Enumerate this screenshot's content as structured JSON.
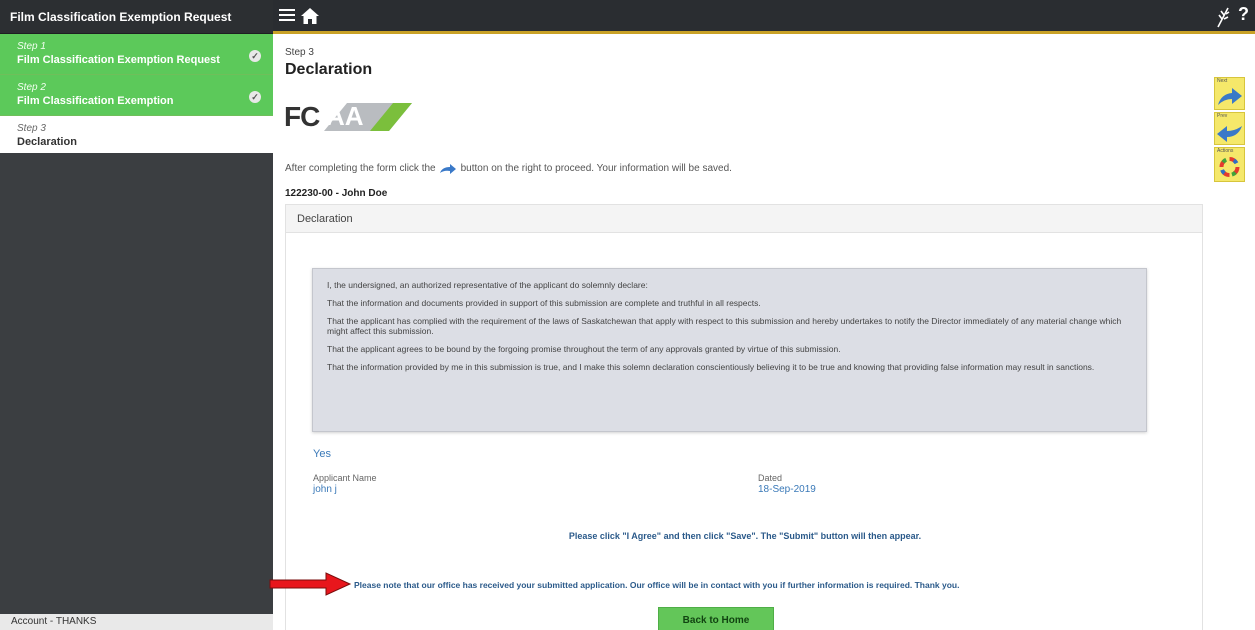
{
  "sidebar": {
    "title": "Film Classification Exemption Request",
    "steps": [
      {
        "num": "Step 1",
        "name": "Film Classification Exemption Request"
      },
      {
        "num": "Step 2",
        "name": "Film Classification Exemption"
      },
      {
        "num": "Step 3",
        "name": "Declaration"
      }
    ],
    "footer": "Account - THANKS"
  },
  "main": {
    "step_label": "Step 3",
    "title": "Declaration",
    "logo_text": "FC",
    "logo_text2": "AA",
    "instructions_before": "After completing the form click the",
    "instructions_after": "button on the right to proceed. Your information will be saved.",
    "applicant_id": "122230-00 - John Doe"
  },
  "panel": {
    "heading": "Declaration",
    "declaration_lines": [
      "I, the undersigned, an authorized representative of the applicant do solemnly declare:",
      "That the information and documents provided in support of this submission are complete and truthful in all respects.",
      "That the applicant has complied with the requirement of the laws of Saskatchewan that apply with respect to this submission and hereby undertakes to notify the Director immediately of any material change which might affect this submission.",
      "That the applicant agrees to be bound by the forgoing promise throughout the term of any approvals granted by virtue of this submission.",
      "That the information provided by me in this submission is true, and I make this solemn declaration conscientiously believing it to be true and knowing that providing false information may result in sanctions."
    ],
    "agreement": "Yes",
    "applicant_name_label": "Applicant Name",
    "applicant_name_value": "john j",
    "dated_label": "Dated",
    "dated_value": "18-Sep-2019",
    "note_agree": "Please click \"I Agree\" and then click \"Save\". The \"Submit\" button will then appear.",
    "note_received": "Please note that our office has received your submitted application. Our office will be in contact with you if further information is required. Thank you.",
    "back_button": "Back to Home"
  },
  "actions": {
    "next": "Next",
    "prev": "Prev",
    "actions": "Actions"
  },
  "topbar": {
    "help": "?"
  },
  "colors": {
    "accent_green": "#5cc95a",
    "topbar_accent": "#c9a227",
    "link_blue": "#3a79b8",
    "note_blue": "#2b5a8a",
    "action_yellow": "#f5e86a"
  },
  "icons": [
    "menu-icon",
    "home-icon",
    "wheat-icon",
    "help-icon",
    "check-icon",
    "next-arrow-icon",
    "prev-arrow-icon",
    "actions-icon",
    "red-arrow-icon"
  ]
}
